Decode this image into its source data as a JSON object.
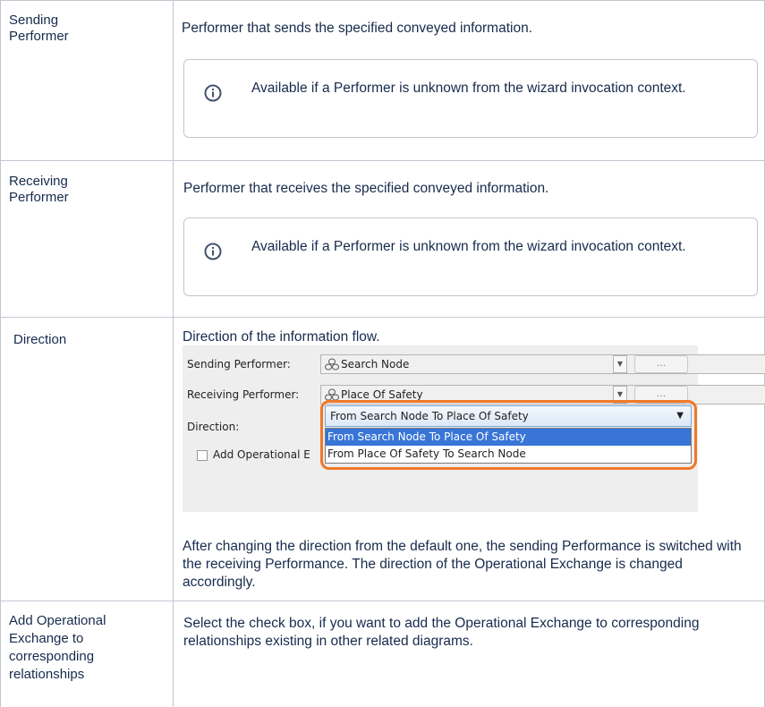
{
  "rows": [
    {
      "label": "Sending Performer",
      "description": "Performer that sends the specified conveyed information.",
      "info": "Available if a Performer is unknown from the wizard invocation context."
    },
    {
      "label": "Receiving Performer",
      "description": "Performer that receives the specified conveyed information.",
      "info": "Available if a Performer is unknown from the wizard invocation context."
    },
    {
      "label": "Direction",
      "description": "Direction of the information flow.",
      "after_text": "After changing the direction from the default one, the sending Performance is switched with the receiving Performance. The direction of the Operational Exchange is changed accordingly."
    },
    {
      "label": "Add Operational Exchange to corresponding relationships",
      "description": "Select the check box, if you want to add the Operational Exchange to corresponding relationships existing in other related diagrams."
    }
  ],
  "screenshot": {
    "sending_label": "Sending Performer:",
    "sending_value": "Search Node",
    "receiving_label": "Receiving Performer:",
    "receiving_value": "Place Of Safety",
    "direction_label": "Direction:",
    "direction_value": "From Search Node To Place Of Safety",
    "options": [
      "From Search Node To Place Of Safety",
      "From Place Of Safety To Search Node"
    ],
    "checkbox_label": "Add Operational E",
    "more_button": "...",
    "highlight_color": "#f0782a",
    "selected_color": "#3875d7"
  }
}
